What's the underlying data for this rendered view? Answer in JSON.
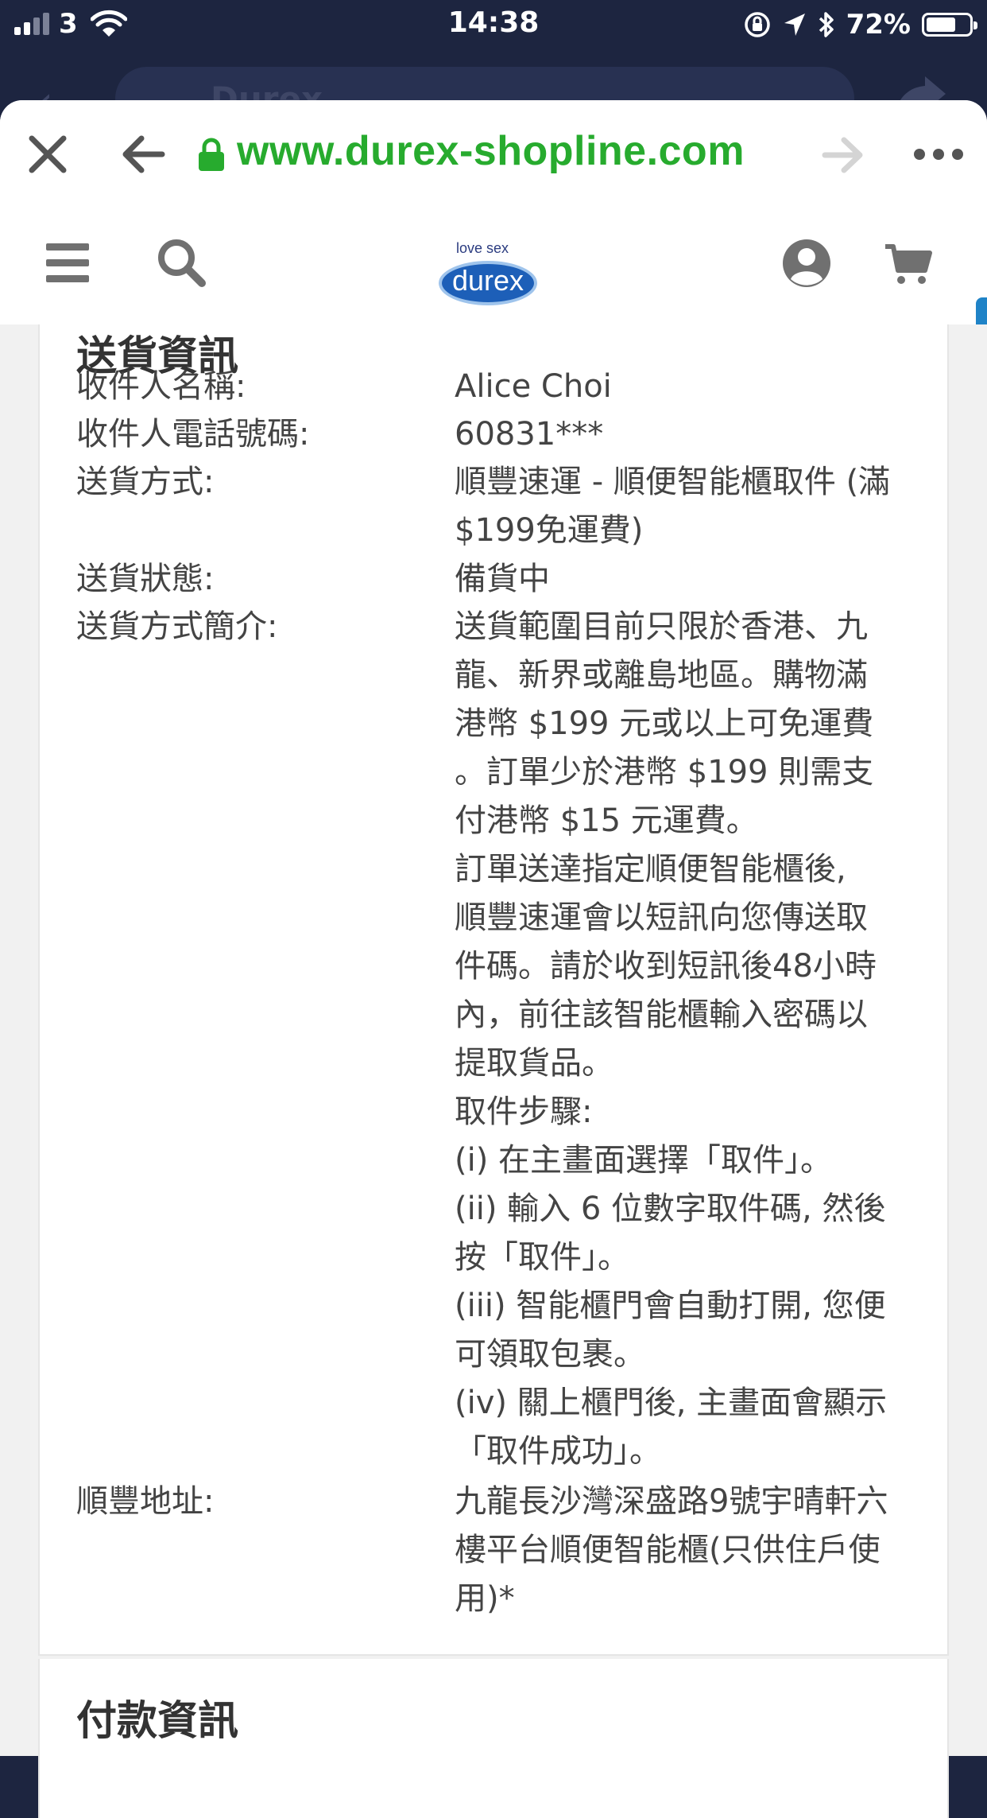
{
  "status_bar": {
    "carrier": "3",
    "time": "14:38",
    "battery": "72%"
  },
  "background_app": {
    "search_text": "Durex"
  },
  "browser": {
    "url": "www.durex-shopline.com"
  },
  "site_header": {
    "logo_tagline": "love sex",
    "logo_word": "durex"
  },
  "shipping": {
    "title": "送貨資訊",
    "rows": [
      {
        "label": "收件人名稱:",
        "value_lines": [
          "Alice Choi"
        ]
      },
      {
        "label": "收件人電話號碼:",
        "value_lines": [
          "60831***"
        ]
      },
      {
        "label": "送貨方式:",
        "value_lines": [
          "順豐速運 - 順便智能櫃取件 (滿",
          "$199免運費)"
        ]
      },
      {
        "label": "送貨狀態:",
        "value_lines": [
          "備貨中"
        ]
      },
      {
        "label": "送貨方式簡介:",
        "value_lines": [
          "送貨範圍目前只限於香港、九",
          "龍、新界或離島地區。購物滿",
          "港幣 $199 元或以上可免運費",
          "。訂單少於港幣 $199 則需支",
          "付港幣 $15 元運費。",
          "訂單送達指定順便智能櫃後,",
          "順豐速運會以短訊向您傳送取",
          "件碼。請於收到短訊後48小時",
          "內，前往該智能櫃輸入密碼以",
          "提取貨品。",
          "取件步驟:",
          "(i) 在主畫面選擇「取件」。",
          "(ii) 輸入 6 位數字取件碼, 然後",
          "按「取件」。",
          "(iii) 智能櫃門會自動打開, 您便",
          "可領取包裹。",
          "(iv) 關上櫃門後, 主畫面會顯示",
          "「取件成功」。"
        ]
      },
      {
        "label": "順豐地址:",
        "value_lines": [
          "九龍長沙灣深盛路9號宇晴軒六",
          "樓平台順便智能櫃(只供住戶使",
          "用)*"
        ]
      }
    ]
  },
  "payment": {
    "title": "付款資訊"
  }
}
